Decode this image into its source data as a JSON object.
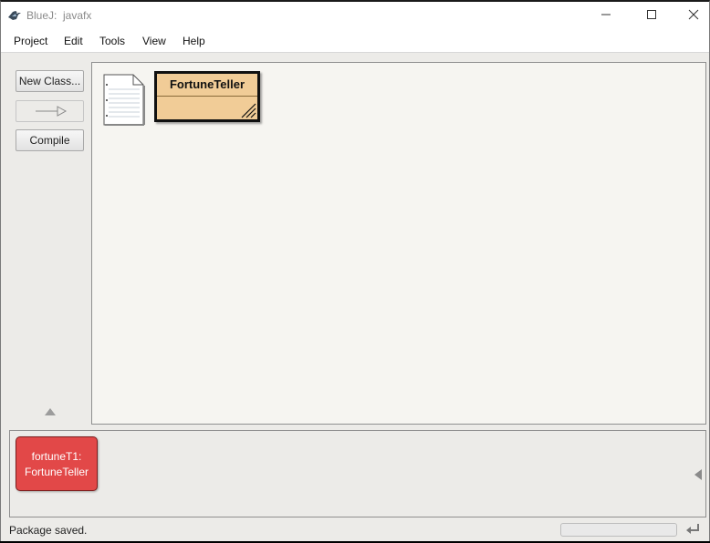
{
  "window": {
    "title": "BlueJ:  javafx",
    "icons": {
      "app": "bluej-bird-icon",
      "minimize": "minimize-icon",
      "maximize": "maximize-icon",
      "close": "close-icon"
    }
  },
  "menubar": {
    "items": [
      {
        "label": "Project"
      },
      {
        "label": "Edit"
      },
      {
        "label": "Tools"
      },
      {
        "label": "View"
      },
      {
        "label": "Help"
      }
    ]
  },
  "toolbar": {
    "new_class_label": "New Class...",
    "arrow_icon": "inheritance-arrow-icon",
    "compile_label": "Compile"
  },
  "diagram": {
    "readme_icon": "readme-document-icon",
    "classes": [
      {
        "name": "FortuneTeller",
        "color": "#f1cc97"
      }
    ]
  },
  "bench": {
    "objects": [
      {
        "name": "fortuneT1:",
        "type": "FortuneTeller",
        "color": "#e24848"
      }
    ]
  },
  "statusbar": {
    "message": "Package saved.",
    "reset_icon": "reset-vm-icon"
  }
}
